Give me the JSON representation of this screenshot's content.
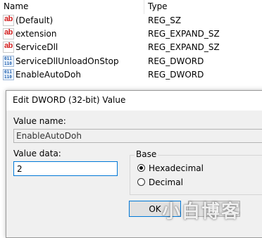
{
  "registry_list": {
    "header": {
      "name": "Name",
      "type": "Type"
    },
    "rows": [
      {
        "icon": "string-value-icon",
        "icon_text": "ab",
        "name": "(Default)",
        "type": "REG_SZ"
      },
      {
        "icon": "string-value-icon",
        "icon_text": "ab",
        "name": "extension",
        "type": "REG_EXPAND_SZ"
      },
      {
        "icon": "string-value-icon",
        "icon_text": "ab",
        "name": "ServiceDll",
        "type": "REG_EXPAND_SZ"
      },
      {
        "icon": "binary-value-icon",
        "icon_text": "011\n110",
        "name": "ServiceDllUnloadOnStop",
        "type": "REG_DWORD"
      },
      {
        "icon": "binary-value-icon",
        "icon_text": "011\n110",
        "name": "EnableAutoDoh",
        "type": "REG_DWORD"
      }
    ]
  },
  "dialog": {
    "title": "Edit DWORD (32-bit) Value",
    "value_name_label": "Value name:",
    "value_name": "EnableAutoDoh",
    "value_data_label": "Value data:",
    "value_data": "2",
    "base_label": "Base",
    "base_options": [
      {
        "label": "Hexadecimal",
        "selected": true
      },
      {
        "label": "Decimal",
        "selected": false
      }
    ],
    "ok_label": "OK",
    "cancel_label": ""
  },
  "watermark": "小白博客"
}
